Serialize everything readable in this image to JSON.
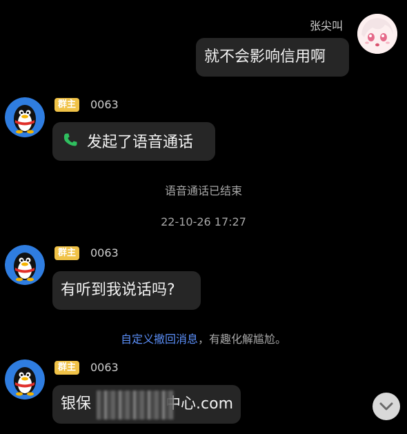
{
  "self_message": {
    "sender": "张尖叫",
    "text": "就不会影响信用啊"
  },
  "messages": [
    {
      "badge": "群主",
      "sender": "0063",
      "text": "发起了语音通话"
    },
    {
      "badge": "群主",
      "sender": "0063",
      "text": "有听到我说话吗?"
    },
    {
      "badge": "群主",
      "sender": "0063",
      "text_visible_left": "银保",
      "text_visible_right": "中心.com"
    }
  ],
  "system": {
    "call_ended": "语音通话已结束",
    "timestamp": "22-10-26 17:27",
    "recall_link": "自定义撤回消息",
    "recall_suffix": "，有趣化解尴尬。"
  },
  "colors": {
    "background": "#000000",
    "bubble": "#262626",
    "badge": "#f0c247",
    "link": "#5b8ff9",
    "call_icon": "#2fbf5f"
  },
  "icons": {
    "call": "phone-icon",
    "scroll_down": "chevron-down-icon"
  }
}
